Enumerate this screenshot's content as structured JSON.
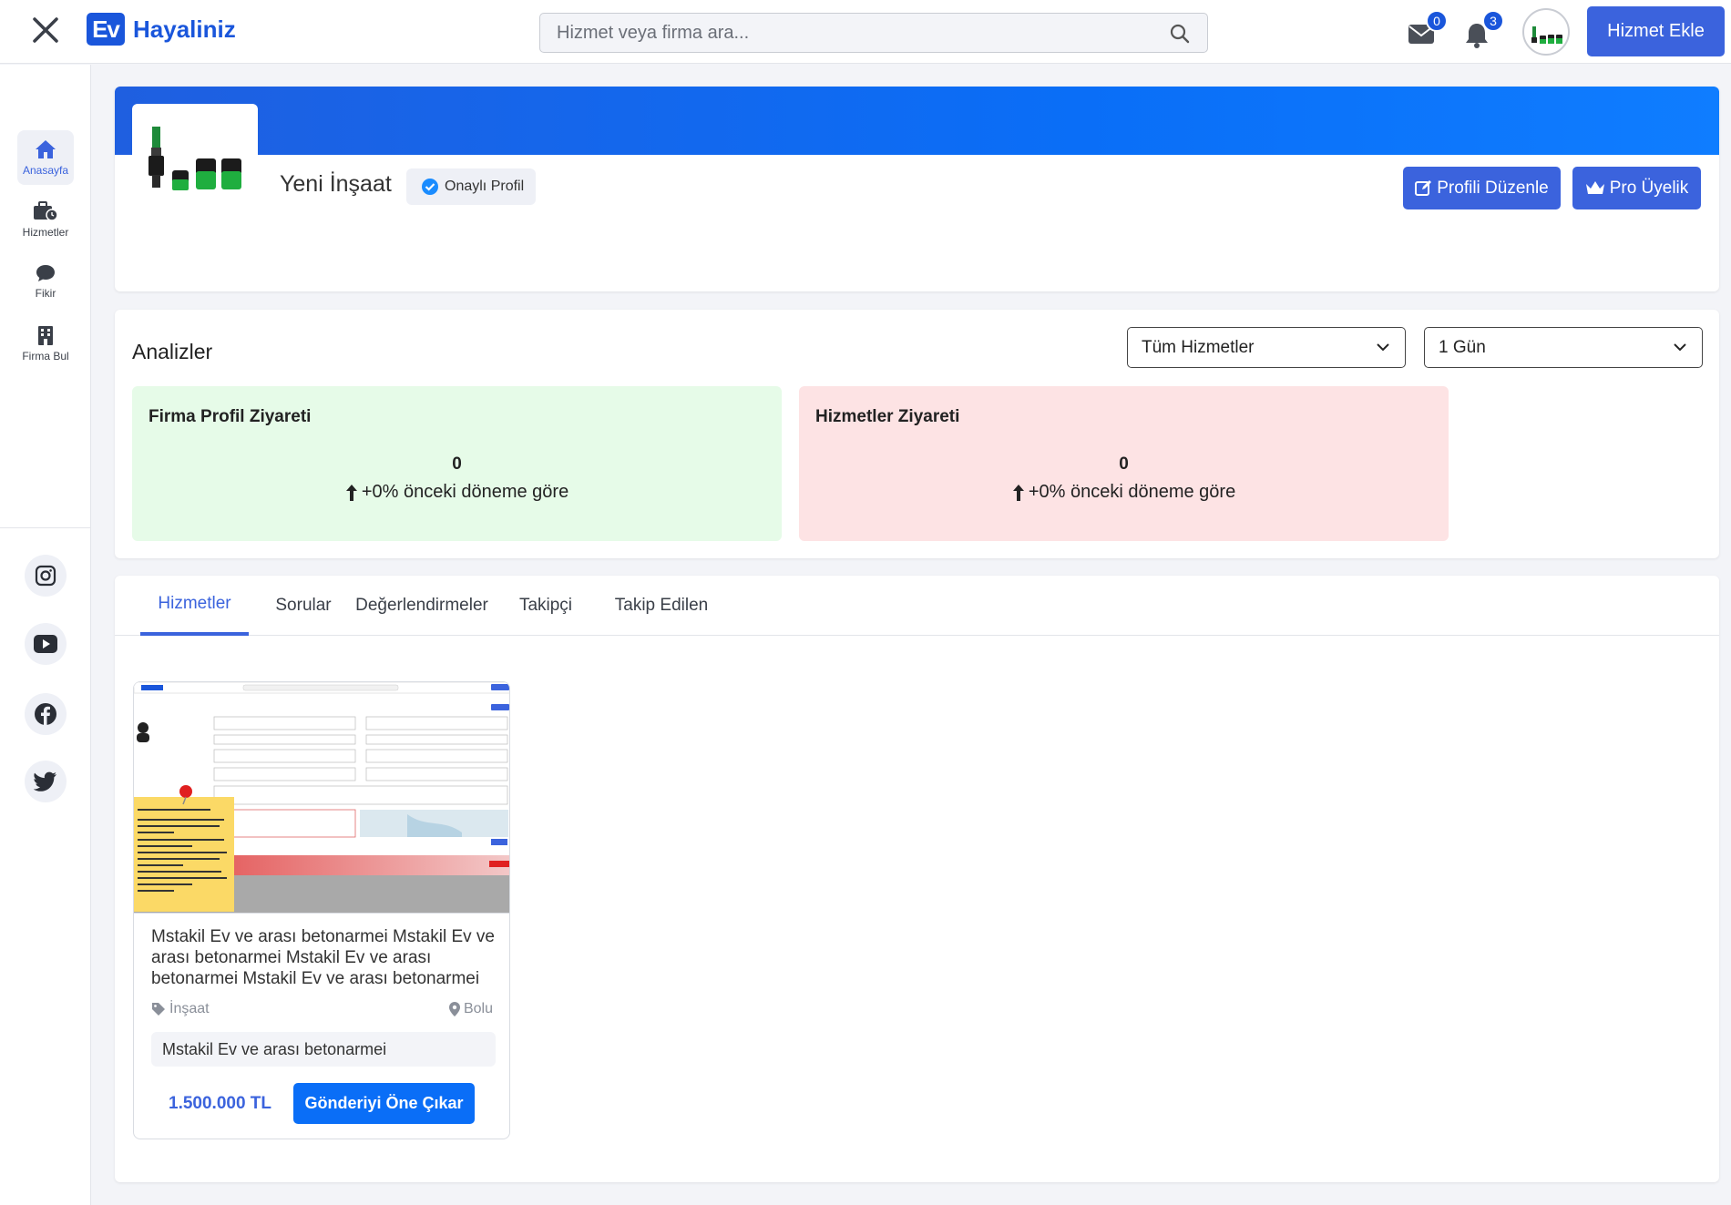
{
  "header": {
    "logo_badge": "Ev",
    "logo_text": "Hayaliniz",
    "search_placeholder": "Hizmet veya firma ara...",
    "messages_count": "0",
    "notifications_count": "3",
    "add_service_label": "Hizmet Ekle"
  },
  "sidebar": {
    "items": [
      {
        "label": "Anasayfa",
        "icon": "home-icon",
        "active": true
      },
      {
        "label": "Hizmetler",
        "icon": "briefcase-clock-icon",
        "active": false
      },
      {
        "label": "Fikir",
        "icon": "chat-bubble-icon",
        "active": false
      },
      {
        "label": "Firma Bul",
        "icon": "building-icon",
        "active": false
      }
    ],
    "socials": [
      "instagram-icon",
      "youtube-icon",
      "facebook-icon",
      "twitter-icon"
    ]
  },
  "profile": {
    "name": "Yeni İnşaat",
    "verified_label": "Onaylı Profil",
    "edit_label": "Profili Düzenle",
    "pro_label": "Pro Üyelik"
  },
  "analytics": {
    "title": "Analizler",
    "service_filter": "Tüm Hizmetler",
    "period_filter": "1 Gün",
    "cards": [
      {
        "title": "Firma Profil Ziyareti",
        "value": "0",
        "delta": "+0% önceki döneme göre",
        "color": "#e6fbe8"
      },
      {
        "title": "Hizmetler Ziyareti",
        "value": "0",
        "delta": "+0% önceki döneme göre",
        "color": "#fde3e4"
      }
    ]
  },
  "tabs": [
    "Hizmetler",
    "Sorular",
    "Değerlendirmeler",
    "Takipçi",
    "Takip Edilen"
  ],
  "service": {
    "title": "Mstakil Ev ve arası betonarmei Mstakil Ev ve arası betonarmei Mstakil Ev ve arası betonarmei Mstakil Ev ve arası betonarmei",
    "category": "İnşaat",
    "location": "Bolu",
    "description": "Mstakil Ev ve arası betonarmei",
    "price": "1.500.000 TL",
    "promote_label": "Gönderiyi Öne Çıkar"
  },
  "colors": {
    "primary": "#3b63dd",
    "brand": "#1a56db",
    "accent": "#0a6ef7"
  }
}
